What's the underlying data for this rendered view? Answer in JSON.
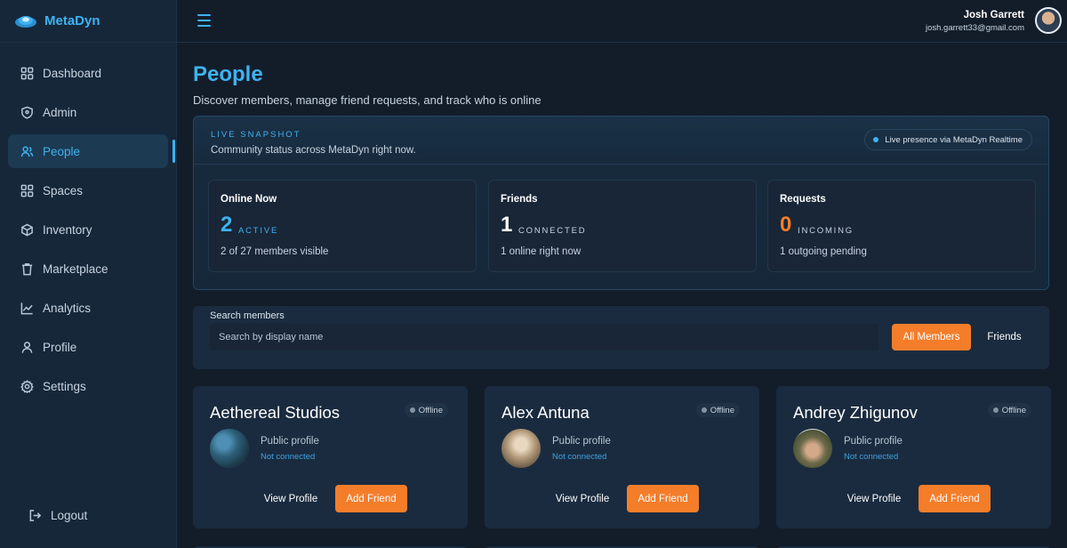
{
  "app": {
    "name": "MetaDyn"
  },
  "sidebar": {
    "items": [
      {
        "label": "Dashboard",
        "icon": "dashboard-grid-icon"
      },
      {
        "label": "Admin",
        "icon": "shield-icon"
      },
      {
        "label": "People",
        "icon": "people-icon",
        "active": true
      },
      {
        "label": "Spaces",
        "icon": "grid-icon"
      },
      {
        "label": "Inventory",
        "icon": "cube-icon"
      },
      {
        "label": "Marketplace",
        "icon": "trash-bag-icon"
      },
      {
        "label": "Analytics",
        "icon": "line-chart-icon"
      },
      {
        "label": "Profile",
        "icon": "user-icon"
      },
      {
        "label": "Settings",
        "icon": "gear-icon"
      }
    ],
    "logout": "Logout"
  },
  "user": {
    "name": "Josh Garrett",
    "email": "josh.garrett33@gmail.com"
  },
  "page": {
    "title": "People",
    "subtitle": "Discover members, manage friend requests, and track who is online"
  },
  "snapshot": {
    "kicker": "LIVE SNAPSHOT",
    "description": "Community status across MetaDyn right now.",
    "presence": "Live presence via MetaDyn Realtime",
    "stats": [
      {
        "label": "Online Now",
        "value": "2",
        "unit": "ACTIVE",
        "foot": "2 of 27 members visible",
        "color": "#3fb2f0"
      },
      {
        "label": "Friends",
        "value": "1",
        "unit": "CONNECTED",
        "foot": "1 online right now",
        "color": "#ffffff"
      },
      {
        "label": "Requests",
        "value": "0",
        "unit": "INCOMING",
        "foot": "1 outgoing pending",
        "color": "#f47d2a"
      }
    ]
  },
  "search": {
    "label": "Search members",
    "placeholder": "Search by display name",
    "all_members": "All Members",
    "friends": "Friends"
  },
  "members": [
    {
      "name": "Aethereal Studios",
      "status": "Offline",
      "visibility": "Public profile",
      "connection": "Not connected",
      "view": "View Profile",
      "add": "Add Friend"
    },
    {
      "name": "Alex Antuna",
      "status": "Offline",
      "visibility": "Public profile",
      "connection": "Not connected",
      "view": "View Profile",
      "add": "Add Friend"
    },
    {
      "name": "Andrey Zhigunov",
      "status": "Offline",
      "visibility": "Public profile",
      "connection": "Not connected",
      "view": "View Profile",
      "add": "Add Friend"
    }
  ],
  "colors": {
    "accent": "#3fb2f0",
    "action": "#f47d2a",
    "background": "#131d2a",
    "card": "#1a2b3f"
  }
}
